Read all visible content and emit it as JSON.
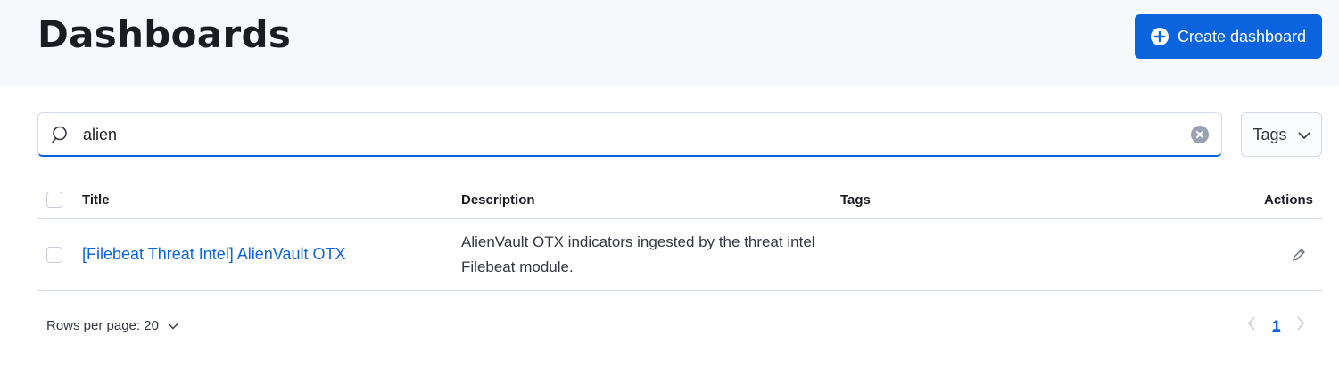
{
  "header": {
    "title": "Dashboards",
    "create_label": "Create dashboard"
  },
  "search": {
    "value": "alien",
    "placeholder": "Search..."
  },
  "filters": {
    "tags_label": "Tags"
  },
  "table": {
    "columns": [
      "Title",
      "Description",
      "Tags",
      "Actions"
    ],
    "rows": [
      {
        "title": "[Filebeat Threat Intel] AlienVault OTX",
        "description": "AlienVault OTX indicators ingested by the threat intel Filebeat module.",
        "tags": ""
      }
    ]
  },
  "pagination": {
    "rows_per_page_label": "Rows per page: 20",
    "current_page": "1"
  },
  "colors": {
    "accent": "#0b64dd",
    "header_bg": "#f7f8fc",
    "border": "#d3dae6"
  },
  "icons": [
    "plus-circle-icon",
    "search-icon",
    "clear-icon",
    "chevron-down-icon",
    "pencil-icon",
    "chevron-left-icon",
    "chevron-right-icon"
  ]
}
